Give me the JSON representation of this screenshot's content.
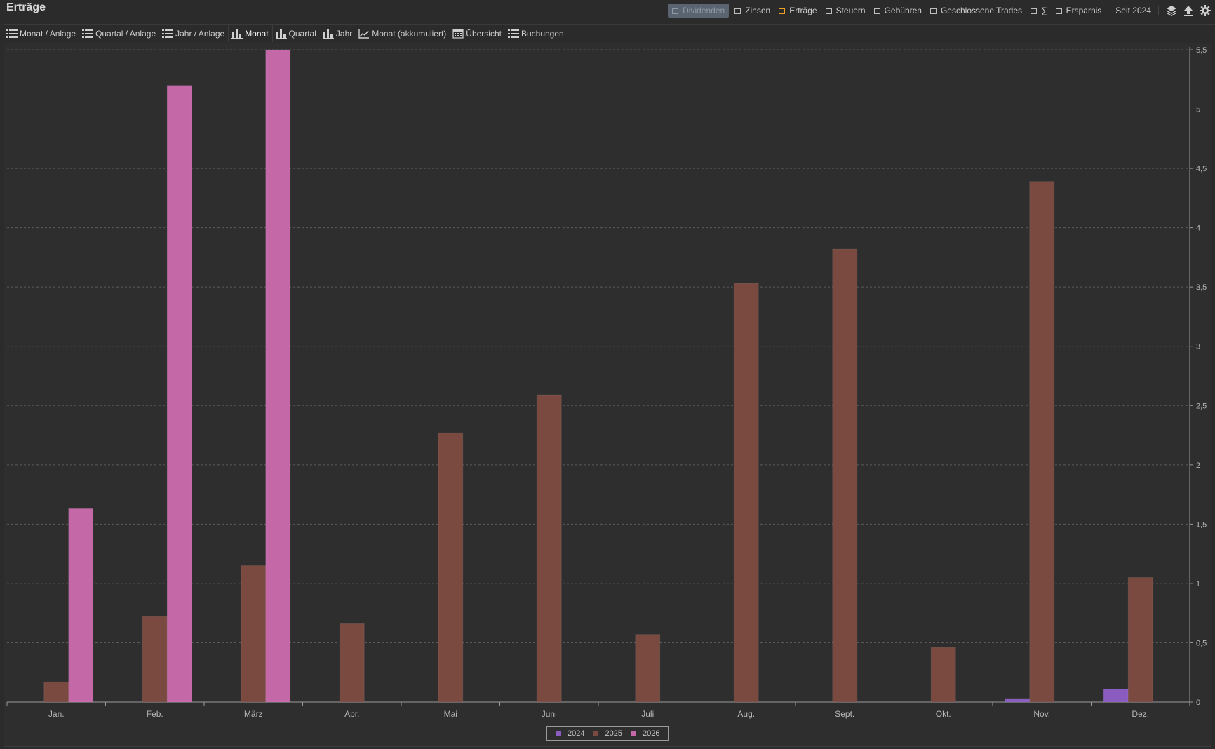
{
  "window": {
    "title": "Erträge"
  },
  "filters": [
    {
      "label": "Dividenden",
      "state": "active"
    },
    {
      "label": "Zinsen",
      "state": "normal"
    },
    {
      "label": "Erträge",
      "state": "orange"
    },
    {
      "label": "Steuern",
      "state": "normal"
    },
    {
      "label": "Gebühren",
      "state": "normal"
    },
    {
      "label": "Geschlossene Trades",
      "state": "normal"
    },
    {
      "label": "∑",
      "state": "normal"
    },
    {
      "label": "Ersparnis",
      "state": "normal"
    }
  ],
  "period": {
    "label": "Seit 2024"
  },
  "toolbar_icons": [
    "layers-icon",
    "export-upload-icon",
    "gear-icon"
  ],
  "tabs": [
    {
      "label": "Monat / Anlage",
      "icon": "list-icon",
      "active": false
    },
    {
      "label": "Quartal / Anlage",
      "icon": "list-icon",
      "active": false
    },
    {
      "label": "Jahr / Anlage",
      "icon": "list-icon",
      "active": false
    },
    {
      "label": "Monat",
      "icon": "bar-chart-icon",
      "active": true
    },
    {
      "label": "Quartal",
      "icon": "bar-chart-icon",
      "active": false
    },
    {
      "label": "Jahr",
      "icon": "bar-chart-icon",
      "active": false
    },
    {
      "label": "Monat (akkumuliert)",
      "icon": "line-chart-icon",
      "active": false
    },
    {
      "label": "Übersicht",
      "icon": "calendar-icon",
      "active": false
    },
    {
      "label": "Buchungen",
      "icon": "list-icon",
      "active": false
    }
  ],
  "chart_data": {
    "type": "bar",
    "categories": [
      "Jan.",
      "Feb.",
      "März",
      "Apr.",
      "Mai",
      "Juni",
      "Juli",
      "Aug.",
      "Sept.",
      "Okt.",
      "Nov.",
      "Dez."
    ],
    "series": [
      {
        "name": "2024",
        "color": "#8a5cc0",
        "values": [
          0,
          0,
          0,
          0,
          0,
          0,
          0,
          0,
          0,
          0,
          0.03,
          0.11
        ]
      },
      {
        "name": "2025",
        "color": "#7a4a40",
        "values": [
          0.17,
          0.72,
          1.15,
          0.66,
          2.27,
          2.59,
          0.57,
          3.53,
          3.82,
          0.46,
          4.39,
          1.05
        ]
      },
      {
        "name": "2026",
        "color": "#c468a8",
        "values": [
          1.63,
          5.2,
          5.5,
          0,
          0,
          0,
          0,
          0,
          0,
          0,
          0,
          0
        ]
      }
    ],
    "yticks": [
      "0",
      "0,5",
      "1",
      "1,5",
      "2",
      "2,5",
      "3",
      "3,5",
      "4",
      "4,5",
      "5",
      "5,5"
    ],
    "ylim": [
      0,
      5.5
    ],
    "grid": true,
    "legend": "bottom-center",
    "yaxis_position": "right"
  }
}
